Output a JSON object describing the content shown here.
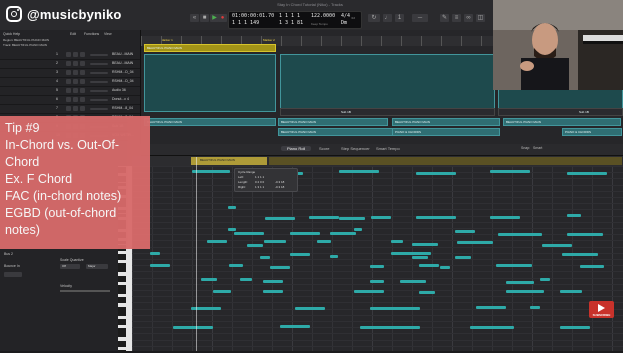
{
  "watermark": {
    "handle": "@musicbyniko"
  },
  "window": {
    "title": "Stay In Chord Tutorial (Niko) - Tracks"
  },
  "transport": {
    "position_time": "01:00:00:01.70",
    "position_bars": "1 1 1 149",
    "end_time": "1 1 1 1",
    "beat": "1 3 1 81",
    "tempo": "122.0000",
    "tempo_label": "Keep Tempo",
    "signature": "4/4",
    "division": "/16",
    "key": "Dm",
    "in_label": "No In",
    "out_label": "No Out"
  },
  "track_header": {
    "quick_help": "Quick Help",
    "region_label": "Region: BEAUTIFUL PIANO MAIN",
    "track_label": "Track: BEAUTIFUL PIANO MAIN",
    "menu": [
      "Edit",
      "Functions",
      "View"
    ]
  },
  "tracks": [
    {
      "num": "1",
      "name": "BEAU...MAIN"
    },
    {
      "num": "2",
      "name": "BEAU...MAIN"
    },
    {
      "num": "3",
      "name": "RSHM...D_04"
    },
    {
      "num": "4",
      "name": "RSHM...D_04"
    },
    {
      "num": "5",
      "name": "Audio 36"
    },
    {
      "num": "6",
      "name": "Donut...c 4"
    },
    {
      "num": "7",
      "name": "RSHM...8_04"
    },
    {
      "num": "8",
      "name": "RSHM...8_04"
    },
    {
      "num": "9",
      "name": "Sub 1B"
    },
    {
      "num": "10",
      "name": "VOX WETR..."
    }
  ],
  "arrange": {
    "markers": [
      "Marker 1",
      "Marker 2"
    ],
    "region_names": [
      "BEAUTIFUL PIANO MAIN",
      "PIANO & CHORDS",
      "Sub 1B"
    ]
  },
  "piano_roll": {
    "tabs": [
      "Piano Roll",
      "Score",
      "Step Sequencer",
      "Smart Tempo"
    ],
    "snap_label": "Snap:",
    "snap_value": "Smart",
    "region_name": "BEAUTIFUL PIANO MAIN",
    "tooltip": {
      "title": "Cycle Range",
      "start_label": "Left:",
      "start_value": "1 1 1 1",
      "length_label": "Length:",
      "length_value": "0 2 0 0",
      "end_label": "Right:",
      "end_value": "1 3 1 1",
      "extra_1": "-0.3 18",
      "extra_2": "-0.3 18"
    }
  },
  "inspector": {
    "label_1": "Bus 2",
    "label_2": "Bounce In",
    "label_3": "Scale Quantize",
    "scale_off": "Off",
    "scale_major": "Major",
    "label_4": "Velocity"
  },
  "tip_card": {
    "lines": [
      "Tip #9",
      "In-Chord vs. Out-Of-",
      "Chord",
      "Ex. F Chord",
      "FAC (in-chord notes)",
      "EGBD (out-of-chord",
      "notes)"
    ]
  },
  "subscribe": {
    "label": "SUBSCRIBE"
  },
  "colors": {
    "region_teal": "#2f6e73",
    "region_yellow": "#a39417",
    "note": "#2eaaa8",
    "tip_card": "#d76a6a",
    "subscribe": "#c8322b"
  }
}
